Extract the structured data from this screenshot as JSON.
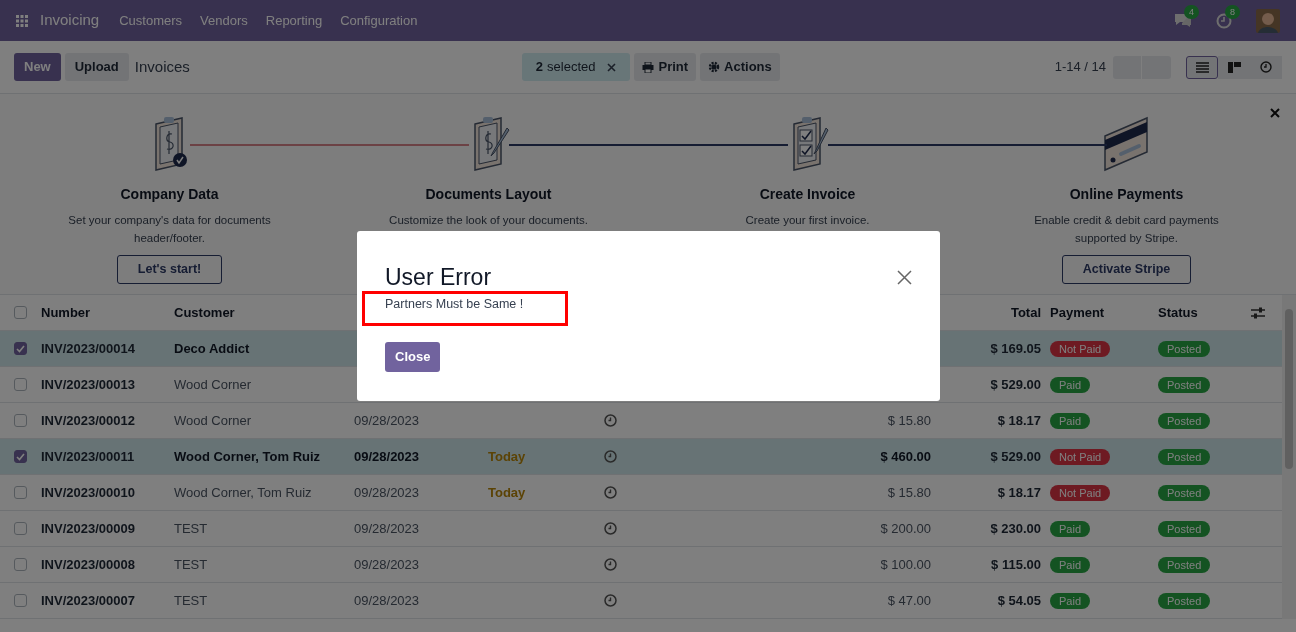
{
  "navbar": {
    "app": "Invoicing",
    "menu": [
      "Customers",
      "Vendors",
      "Reporting",
      "Configuration"
    ],
    "messages_count": "4",
    "activities_count": "8"
  },
  "control_panel": {
    "new_button": "New",
    "upload_button": "Upload",
    "title": "Invoices",
    "selection_count": "2",
    "selection_text": "selected",
    "print_button": "Print",
    "actions_button": "Actions",
    "pager": "1-14 / 14",
    "views": [
      {
        "kind": "list",
        "selected": true
      },
      {
        "kind": "kanban",
        "selected": false
      },
      {
        "kind": "activity",
        "selected": false
      }
    ]
  },
  "onboarding": {
    "steps": [
      {
        "kind": "company",
        "title": "Company Data",
        "description": "Set your company's data for documents header/footer.",
        "button": "Let's start!"
      },
      {
        "kind": "layout",
        "title": "Documents Layout",
        "description": "Customize the look of your documents."
      },
      {
        "kind": "invoice",
        "title": "Create Invoice",
        "description": "Create your first invoice."
      },
      {
        "kind": "payment",
        "title": "Online Payments",
        "description": "Enable credit & debit card payments supported by Stripe.",
        "button": "Activate Stripe"
      }
    ],
    "connectors": [
      {
        "color": "#6c4245"
      },
      {
        "color": "#161d33"
      },
      {
        "color": "#161d33"
      }
    ]
  },
  "table": {
    "all_selected": false,
    "columns": [
      {
        "label": "Number",
        "kind": "number"
      },
      {
        "label": "Customer",
        "kind": "customer"
      },
      {
        "label": "Total",
        "kind": "total"
      },
      {
        "label": "Payment",
        "kind": "payment"
      },
      {
        "label": "Status",
        "kind": "status"
      }
    ],
    "rows": [
      {
        "selected": true,
        "number": "INV/2023/00014",
        "customer": "Deco Addict",
        "total": "$ 169.05",
        "payment": {
          "label": "Not Paid",
          "kind": "not_paid"
        },
        "status": "Posted"
      },
      {
        "selected": false,
        "number": "INV/2023/00013",
        "customer": "Wood Corner",
        "total": "$ 529.00",
        "payment": {
          "label": "Paid",
          "kind": "paid"
        },
        "status": "Posted"
      },
      {
        "selected": false,
        "number": "INV/2023/00012",
        "customer": "Wood Corner",
        "date": "09/28/2023",
        "untaxed": "$ 15.80",
        "total": "$ 18.17",
        "payment": {
          "label": "Paid",
          "kind": "paid"
        },
        "status": "Posted"
      },
      {
        "selected": true,
        "number": "INV/2023/00011",
        "customer": "Wood Corner, Tom Ruiz",
        "date": "09/28/2023",
        "due": "Today",
        "untaxed": "$ 460.00",
        "total": "$ 529.00",
        "payment": {
          "label": "Not Paid",
          "kind": "not_paid"
        },
        "status": "Posted"
      },
      {
        "selected": false,
        "number": "INV/2023/00010",
        "customer": "Wood Corner, Tom Ruiz",
        "date": "09/28/2023",
        "due": "Today",
        "untaxed": "$ 15.80",
        "total": "$ 18.17",
        "payment": {
          "label": "Not Paid",
          "kind": "not_paid"
        },
        "status": "Posted"
      },
      {
        "selected": false,
        "number": "INV/2023/00009",
        "customer": "TEST",
        "date": "09/28/2023",
        "untaxed": "$ 200.00",
        "total": "$ 230.00",
        "payment": {
          "label": "Paid",
          "kind": "paid"
        },
        "status": "Posted"
      },
      {
        "selected": false,
        "number": "INV/2023/00008",
        "customer": "TEST",
        "date": "09/28/2023",
        "untaxed": "$ 100.00",
        "total": "$ 115.00",
        "payment": {
          "label": "Paid",
          "kind": "paid"
        },
        "status": "Posted"
      },
      {
        "selected": false,
        "number": "INV/2023/00007",
        "customer": "TEST",
        "date": "09/28/2023",
        "untaxed": "$ 47.00",
        "total": "$ 54.05",
        "payment": {
          "label": "Paid",
          "kind": "paid"
        },
        "status": "Posted"
      }
    ]
  },
  "dialog": {
    "title": "User Error",
    "message": "Partners Must be Same !",
    "button": "Close"
  }
}
